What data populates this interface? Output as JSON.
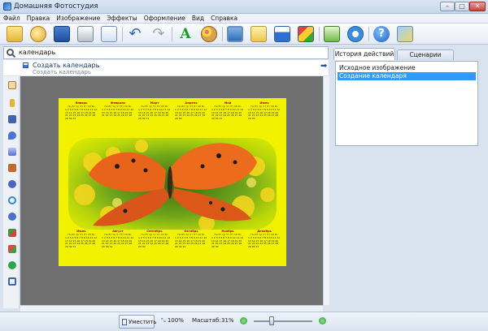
{
  "window": {
    "title": "Домашняя Фотостудия",
    "controls": [
      "–",
      "□",
      "✕"
    ]
  },
  "menu": [
    "Файл",
    "Правка",
    "Изображение",
    "Эффекты",
    "Оформление",
    "Вид",
    "Справка"
  ],
  "toolbar": {
    "icons": [
      "open-folder-icon",
      "effects-icon",
      "save-icon",
      "print-icon",
      "copy-icon",
      "undo-icon",
      "redo-icon",
      "text-icon",
      "palette-icon",
      "frame-icon",
      "card-icon",
      "calendar-icon",
      "collage-icon",
      "crop-icon",
      "compare-icon",
      "help-icon",
      "package-icon"
    ]
  },
  "search": {
    "value": "календарь",
    "placeholder": ""
  },
  "results": [
    {
      "title": "Создать календарь",
      "subtitle": "Создать календарь"
    }
  ],
  "tabs": [
    {
      "label": "История действий",
      "active": true
    },
    {
      "label": "Сценарии",
      "active": false
    }
  ],
  "history": [
    {
      "label": "Исходное изображение",
      "selected": false
    },
    {
      "label": "Создание календаря",
      "selected": true
    }
  ],
  "calendar": {
    "weekdays": "Пн Вт Ср Чт Пт Сб Вс",
    "top_months": [
      "Январь",
      "Февраль",
      "Март",
      "Апрель",
      "Май",
      "Июнь"
    ],
    "bottom_months": [
      "Июль",
      "Август",
      "Сентябрь",
      "Октябрь",
      "Ноябрь",
      "Декабрь"
    ]
  },
  "status": {
    "fit_label": "Уместить",
    "zoom_100": "100%",
    "scale_label": "Масштаб:",
    "scale_value": "31%",
    "zoom_slider_level": 0.3
  },
  "colors": {
    "accent": "#3399ff",
    "calendar_bg": "#f2f200",
    "canvas_bg": "#6f6f6f",
    "panel_bg": "#d9e3ef",
    "selected": "#3399ff"
  }
}
